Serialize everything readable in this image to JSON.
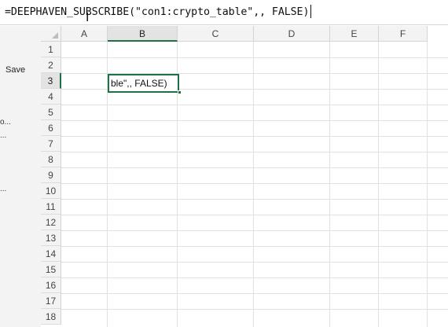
{
  "formula_bar": {
    "formula_text": "=DEEPHAVEN_SUBSCRIBE(\"con1:crypto_table\",, FALSE)"
  },
  "left_pane": {
    "save_label": "Save",
    "items": [
      "o...",
      "...",
      "..."
    ]
  },
  "grid": {
    "columns": [
      "A",
      "B",
      "C",
      "D",
      "E",
      "F"
    ],
    "selected_column": "B",
    "rows": [
      "1",
      "2",
      "3",
      "4",
      "5",
      "6",
      "7",
      "8",
      "9",
      "10",
      "11",
      "12",
      "13",
      "14",
      "15",
      "16",
      "17",
      "18"
    ],
    "selected_row": "3",
    "active_cell": {
      "address": "B3",
      "display_text": "ble\",, FALSE)"
    }
  },
  "colors": {
    "accent": "#1e7145",
    "header_bg": "#f3f3f3",
    "gridline": "#e1e1e1"
  }
}
